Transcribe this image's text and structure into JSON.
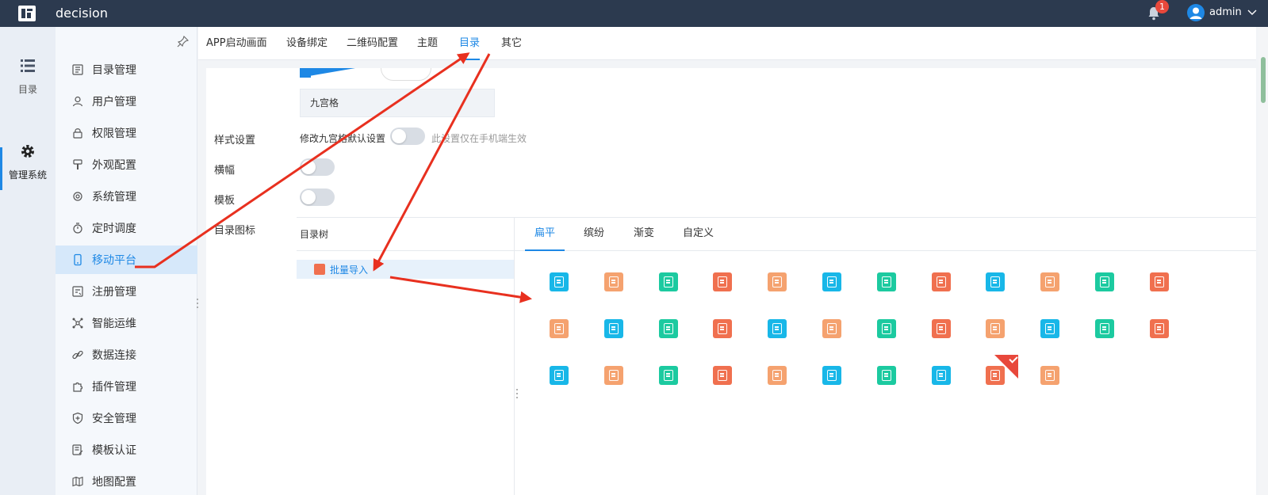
{
  "topbar": {
    "app_title": "decision",
    "notifications_count": "1",
    "user_name": "admin"
  },
  "rail": {
    "items": [
      {
        "label": "目录",
        "icon": "list-icon"
      },
      {
        "label": "管理系统",
        "icon": "gear-icon"
      }
    ]
  },
  "sidebar": {
    "items": [
      {
        "label": "目录管理",
        "icon": "catalog-icon"
      },
      {
        "label": "用户管理",
        "icon": "user-icon"
      },
      {
        "label": "权限管理",
        "icon": "lock-icon"
      },
      {
        "label": "外观配置",
        "icon": "brush-icon"
      },
      {
        "label": "系统管理",
        "icon": "gear-icon"
      },
      {
        "label": "定时调度",
        "icon": "stopwatch-icon"
      },
      {
        "label": "移动平台",
        "icon": "mobile-icon",
        "active": true
      },
      {
        "label": "注册管理",
        "icon": "register-icon"
      },
      {
        "label": "智能运维",
        "icon": "network-icon"
      },
      {
        "label": "数据连接",
        "icon": "link-icon"
      },
      {
        "label": "插件管理",
        "icon": "puzzle-icon"
      },
      {
        "label": "安全管理",
        "icon": "shield-icon"
      },
      {
        "label": "模板认证",
        "icon": "template-icon"
      },
      {
        "label": "地图配置",
        "icon": "map-icon"
      }
    ]
  },
  "tabs": [
    "APP启动画面",
    "设备绑定",
    "二维码配置",
    "主题",
    "目录",
    "其它"
  ],
  "active_tab": "目录",
  "settings": {
    "grid_label": "九宫格",
    "style_label": "样式设置",
    "style_toggle_text": "修改九宫格默认设置",
    "style_hint": "此设置仅在手机端生效",
    "banner_label": "横幅",
    "template_label": "模板",
    "catalog_icon_label": "目录图标"
  },
  "tree": {
    "header": "目录树",
    "node_label": "批量导入"
  },
  "icon_tabs": [
    "扁平",
    "缤纷",
    "渐变",
    "自定义"
  ],
  "active_icon_tab": "扁平",
  "icon_rows": [
    [
      "#18b7e8",
      "#f5a26f",
      "#1ccaa0",
      "#f0704f",
      "#f5a26f",
      "#18b7e8",
      "#1ccaa0",
      "#f0704f",
      "#18b7e8",
      "#f5a26f",
      "#1ccaa0",
      "#f0704f"
    ],
    [
      "#f5a26f",
      "#18b7e8",
      "#1ccaa0",
      "#f0704f",
      "#18b7e8",
      "#f5a26f",
      "#1ccaa0",
      "#f0704f",
      "#f5a26f",
      "#18b7e8",
      "#1ccaa0",
      "#f0704f"
    ],
    [
      "#18b7e8",
      "#f5a26f",
      "#1ccaa0",
      "#f0704f",
      "#f5a26f",
      "#18b7e8",
      "#1ccaa0",
      "#18b7e8",
      "#f0704f",
      "#f5a26f"
    ]
  ],
  "colors": {
    "accent": "#1e88e5",
    "topbar": "#2c3a4f",
    "annotation_arrow": "#e8301f"
  }
}
